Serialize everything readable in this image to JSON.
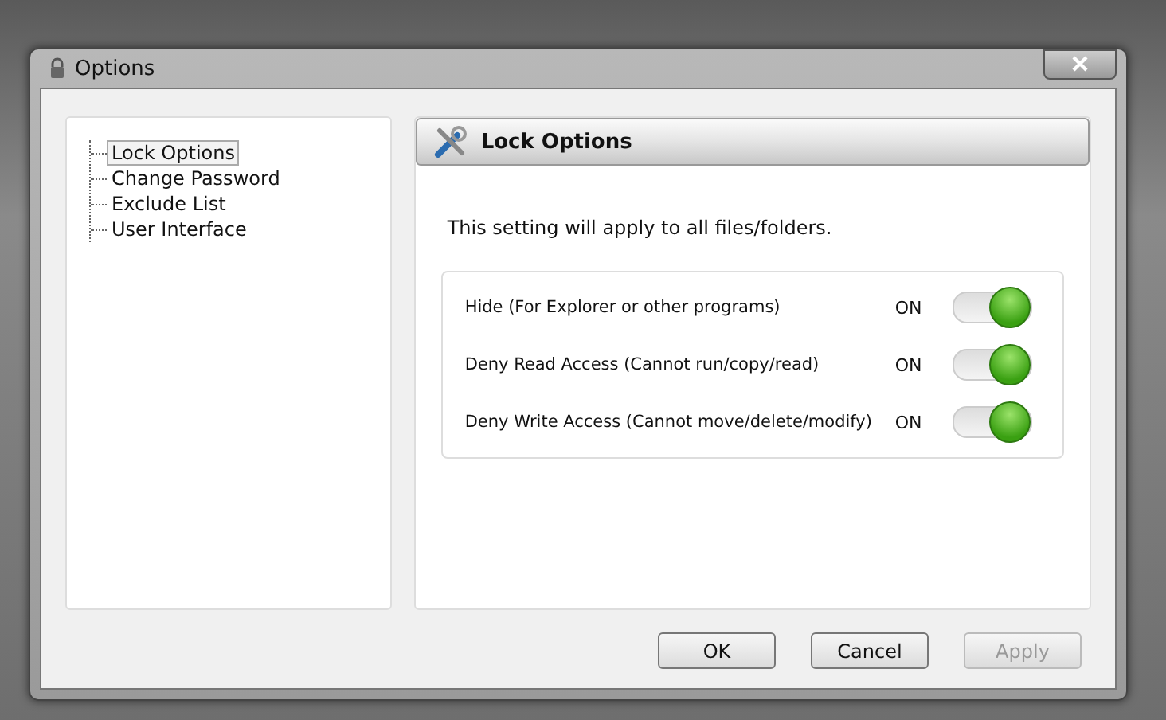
{
  "window": {
    "title": "Options"
  },
  "tree": {
    "items": [
      {
        "label": "Lock Options",
        "selected": true
      },
      {
        "label": "Change Password",
        "selected": false
      },
      {
        "label": "Exclude List",
        "selected": false
      },
      {
        "label": "User Interface",
        "selected": false
      }
    ]
  },
  "panel": {
    "title": "Lock Options",
    "description": "This setting will apply to all files/folders.",
    "options": [
      {
        "label": "Hide (For Explorer or other programs)",
        "state_text": "ON",
        "on": true
      },
      {
        "label": "Deny Read Access (Cannot run/copy/read)",
        "state_text": "ON",
        "on": true
      },
      {
        "label": "Deny Write Access (Cannot move/delete/modify)",
        "state_text": "ON",
        "on": true
      }
    ]
  },
  "buttons": [
    {
      "label": "OK",
      "disabled": false
    },
    {
      "label": "Cancel",
      "disabled": false
    },
    {
      "label": "Apply",
      "disabled": true
    }
  ]
}
